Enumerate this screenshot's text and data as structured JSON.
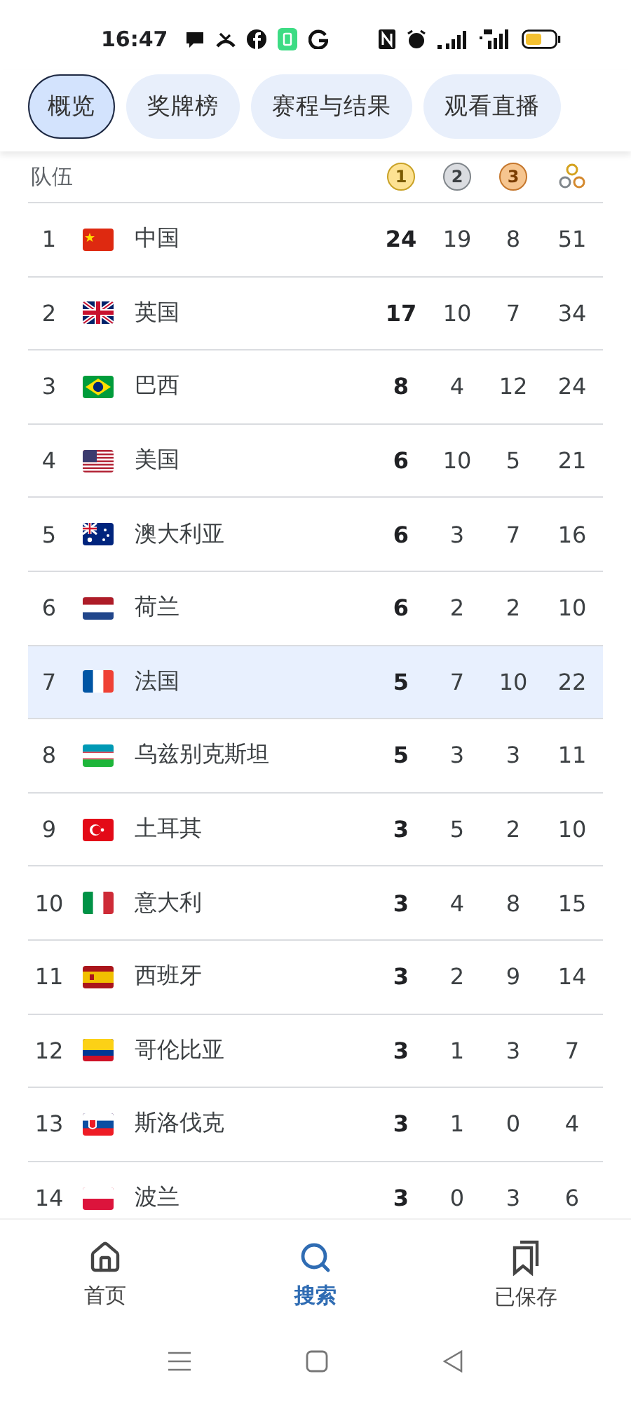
{
  "status_bar": {
    "time": "16:47"
  },
  "tabs": [
    {
      "label": "概览",
      "selected": true
    },
    {
      "label": "奖牌榜",
      "selected": false
    },
    {
      "label": "赛程与结果",
      "selected": false
    },
    {
      "label": "观看直播",
      "selected": false
    }
  ],
  "table": {
    "team_header": "队伍",
    "medal_headers": [
      "1",
      "2",
      "3"
    ],
    "rows": [
      {
        "rank": "1",
        "team": "中国",
        "gold": "24",
        "silver": "19",
        "bronze": "8",
        "total": "51",
        "selected": false
      },
      {
        "rank": "2",
        "team": "英国",
        "gold": "17",
        "silver": "10",
        "bronze": "7",
        "total": "34",
        "selected": false
      },
      {
        "rank": "3",
        "team": "巴西",
        "gold": "8",
        "silver": "4",
        "bronze": "12",
        "total": "24",
        "selected": false
      },
      {
        "rank": "4",
        "team": "美国",
        "gold": "6",
        "silver": "10",
        "bronze": "5",
        "total": "21",
        "selected": false
      },
      {
        "rank": "5",
        "team": "澳大利亚",
        "gold": "6",
        "silver": "3",
        "bronze": "7",
        "total": "16",
        "selected": false
      },
      {
        "rank": "6",
        "team": "荷兰",
        "gold": "6",
        "silver": "2",
        "bronze": "2",
        "total": "10",
        "selected": false
      },
      {
        "rank": "7",
        "team": "法国",
        "gold": "5",
        "silver": "7",
        "bronze": "10",
        "total": "22",
        "selected": true
      },
      {
        "rank": "8",
        "team": "乌兹别克斯坦",
        "gold": "5",
        "silver": "3",
        "bronze": "3",
        "total": "11",
        "selected": false
      },
      {
        "rank": "9",
        "team": "土耳其",
        "gold": "3",
        "silver": "5",
        "bronze": "2",
        "total": "10",
        "selected": false
      },
      {
        "rank": "10",
        "team": "意大利",
        "gold": "3",
        "silver": "4",
        "bronze": "8",
        "total": "15",
        "selected": false
      },
      {
        "rank": "11",
        "team": "西班牙",
        "gold": "3",
        "silver": "2",
        "bronze": "9",
        "total": "14",
        "selected": false
      },
      {
        "rank": "12",
        "team": "哥伦比亚",
        "gold": "3",
        "silver": "1",
        "bronze": "3",
        "total": "7",
        "selected": false
      },
      {
        "rank": "13",
        "team": "斯洛伐克",
        "gold": "3",
        "silver": "1",
        "bronze": "0",
        "total": "4",
        "selected": false
      },
      {
        "rank": "14",
        "team": "波兰",
        "gold": "3",
        "silver": "0",
        "bronze": "3",
        "total": "6",
        "selected": false
      }
    ]
  },
  "bottom_nav": [
    {
      "label": "首页",
      "selected": false
    },
    {
      "label": "搜索",
      "selected": true
    },
    {
      "label": "已保存",
      "selected": false
    }
  ]
}
